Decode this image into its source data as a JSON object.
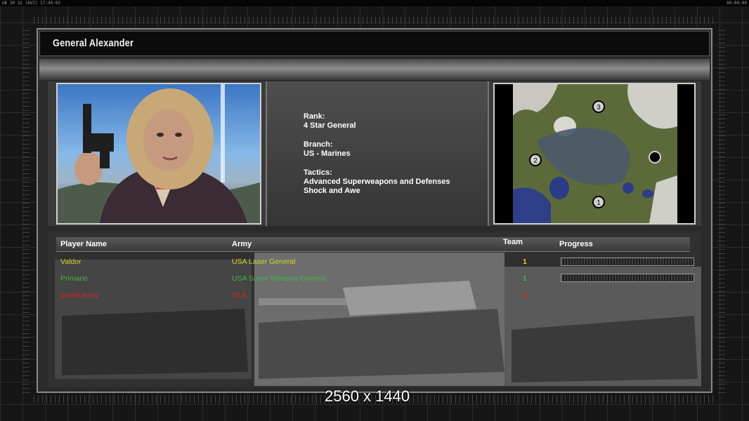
{
  "statusbar": {
    "left": "UK 30 32 (AVI) 17:44:02",
    "right": "00:00:00"
  },
  "general": {
    "name": "General Alexander",
    "rank_label": "Rank:",
    "rank": "4 Star General",
    "branch_label": "Branch:",
    "branch": "US - Marines",
    "tactics_label": "Tactics:",
    "tactics": [
      "Advanced Superweapons and Defenses",
      "Shock and Awe"
    ]
  },
  "minimap": {
    "markers": [
      "3",
      "2",
      "1"
    ]
  },
  "table": {
    "headers": {
      "player": "Player Name",
      "army": "Army",
      "team": "Team",
      "progress": "Progress"
    },
    "rows": [
      {
        "player": "Valdor",
        "army": "USA Laser General",
        "team": "1",
        "color": "#d6d62a",
        "progress": 1.0
      },
      {
        "player": "Primarie",
        "army": "USA Super Weapon General",
        "team": "1",
        "color": "#3cb84a",
        "progress": 1.0
      },
      {
        "player": "Brutal Army",
        "army": "GLA",
        "team": "2",
        "color": "#e02020",
        "progress": null
      }
    ]
  },
  "resolution_label": "2560 x 1440",
  "colors": {
    "player1": "#d6d62a",
    "player2": "#3cb84a",
    "player3": "#e02020"
  }
}
